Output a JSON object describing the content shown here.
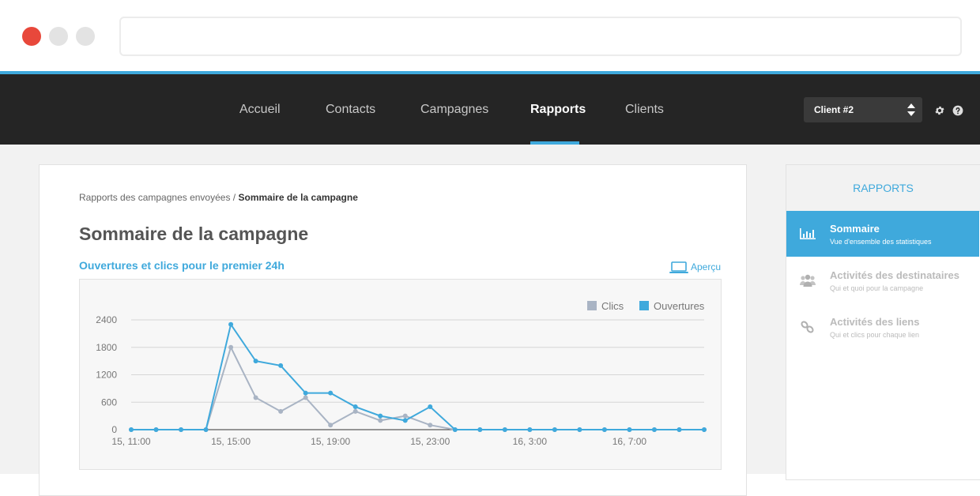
{
  "window": {
    "close_color": "#e8483b",
    "button_color": "#e3e3e3",
    "url": ""
  },
  "nav": {
    "items": [
      {
        "label": "Accueil",
        "active": false
      },
      {
        "label": "Contacts",
        "active": false
      },
      {
        "label": "Campagnes",
        "active": false
      },
      {
        "label": "Rapports",
        "active": true
      },
      {
        "label": "Clients",
        "active": false
      }
    ],
    "client_select": "Client #2",
    "settings_icon": "gear-icon",
    "help_icon": "help-icon",
    "accent": "#3fa9dc",
    "background": "#252525"
  },
  "breadcrumb": {
    "parent": "Rapports des campagnes envoyées",
    "separator": "/",
    "current": "Sommaire de la campagne"
  },
  "page_title": "Sommaire de la campagne",
  "section_title": "Ouvertures et clics pour le premier 24h",
  "preview_label": "Aperçu",
  "chart_data": {
    "type": "line",
    "title": "",
    "xlabel": "",
    "ylabel": "",
    "ylim": [
      0,
      2400
    ],
    "yticks": [
      0,
      600,
      1200,
      1800,
      2400
    ],
    "xticks": [
      {
        "index": 0,
        "label": "15, 11:00"
      },
      {
        "index": 4,
        "label": "15, 15:00"
      },
      {
        "index": 8,
        "label": "15, 19:00"
      },
      {
        "index": 12,
        "label": "15, 23:00"
      },
      {
        "index": 16,
        "label": "16, 3:00"
      },
      {
        "index": 20,
        "label": "16, 7:00"
      }
    ],
    "x": [
      "15, 11:00",
      "15, 12:00",
      "15, 13:00",
      "15, 14:00",
      "15, 15:00",
      "15, 16:00",
      "15, 17:00",
      "15, 18:00",
      "15, 19:00",
      "15, 20:00",
      "15, 21:00",
      "15, 22:00",
      "15, 23:00",
      "16, 0:00",
      "16, 1:00",
      "16, 2:00",
      "16, 3:00",
      "16, 4:00",
      "16, 5:00",
      "16, 6:00",
      "16, 7:00",
      "16, 8:00",
      "16, 9:00",
      "16, 10:00"
    ],
    "series": [
      {
        "name": "Clics",
        "color": "#a9b4c4",
        "values": [
          0,
          0,
          0,
          0,
          1800,
          700,
          400,
          700,
          100,
          400,
          200,
          300,
          100,
          0,
          0,
          0,
          0,
          0,
          0,
          0,
          0,
          0,
          0,
          0
        ]
      },
      {
        "name": "Ouvertures",
        "color": "#3fa9dc",
        "values": [
          0,
          0,
          0,
          0,
          2300,
          1500,
          1400,
          800,
          800,
          500,
          300,
          200,
          500,
          0,
          0,
          0,
          0,
          0,
          0,
          0,
          0,
          0,
          0,
          0
        ]
      }
    ],
    "grid": true,
    "legend": "top-right"
  },
  "sidebar": {
    "header": "RAPPORTS",
    "items": [
      {
        "label": "Sommaire",
        "desc": "Vue d'ensemble des statistiques",
        "icon": "bar-chart-icon",
        "active": true
      },
      {
        "label": "Activités des destinataires",
        "desc": "Qui et quoi pour la campagne",
        "icon": "users-icon",
        "active": false
      },
      {
        "label": "Activités des liens",
        "desc": "Qui et clics pour chaque lien",
        "icon": "link-icon",
        "active": false
      }
    ]
  }
}
